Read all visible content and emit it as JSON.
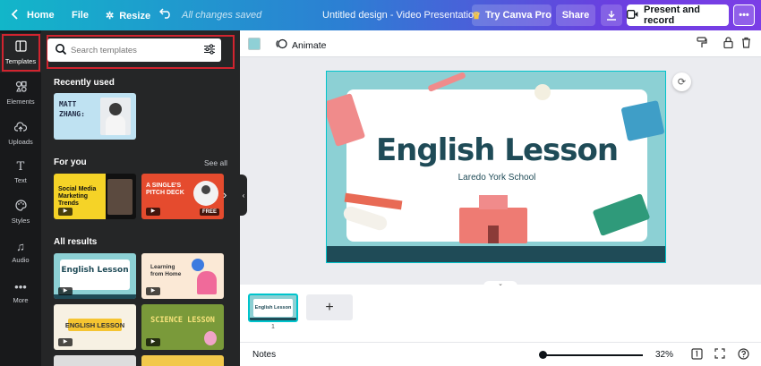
{
  "topbar": {
    "home": "Home",
    "file": "File",
    "resize": "Resize",
    "saved_status": "All changes saved",
    "title": "Untitled design - Video Presentation",
    "try_pro": "Try Canva Pro",
    "share": "Share",
    "present": "Present and record"
  },
  "rail": [
    {
      "label": "Templates"
    },
    {
      "label": "Elements"
    },
    {
      "label": "Uploads"
    },
    {
      "label": "Text"
    },
    {
      "label": "Styles"
    },
    {
      "label": "Audio"
    },
    {
      "label": "More"
    }
  ],
  "panel": {
    "search_placeholder": "Search templates",
    "recently_used": "Recently used",
    "recent_thumb_text": "MATT ZHANG:",
    "for_you": "For you",
    "see_all": "See all",
    "for_you_1": "Social Media Marketing Trends",
    "for_you_2": "A SINGLE'S PITCH DECK",
    "free_badge": "FREE",
    "all_results": "All results",
    "result_1": "English Lesson",
    "result_2": "Learning from Home",
    "result_3": "ENGLISH LESSON",
    "result_4": "SCIENCE LESSON"
  },
  "editor": {
    "animate": "Animate",
    "slide_title": "English Lesson",
    "slide_subtitle": "Laredo York School",
    "page_thumb_text": "English Lesson",
    "page_number": "1"
  },
  "footer": {
    "notes": "Notes",
    "zoom": "32%",
    "zoom_fraction": 0.32
  },
  "colors": {
    "accent": "#00c4cc",
    "panel_bg": "#252627",
    "rail_bg": "#18191b",
    "highlight": "#d1242f",
    "slide_bg": "#8cd0d4",
    "slide_text": "#1f4b57"
  }
}
